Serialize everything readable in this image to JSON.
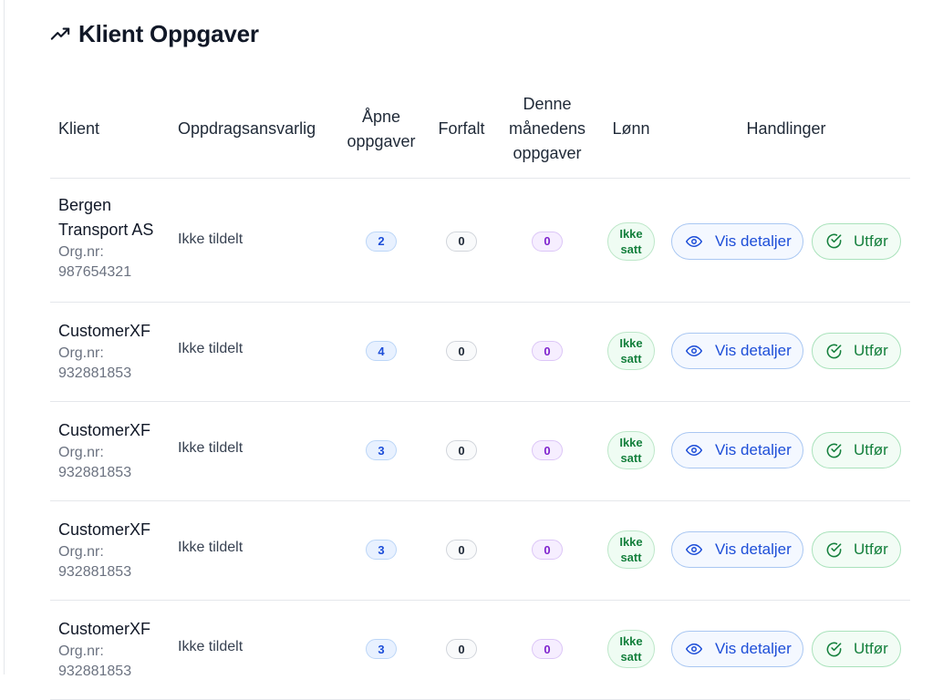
{
  "page": {
    "title": "Klient Oppgaver",
    "title_icon": "trending-up-icon"
  },
  "colors": {
    "blue": "#1d4ed8",
    "green": "#15803d",
    "purple": "#7e22ce",
    "gray": "#6b7280"
  },
  "table": {
    "headers": {
      "client": "Klient",
      "responsible": "Oppdragsansvarlig",
      "open_tasks": [
        "Åpne",
        "oppgaver"
      ],
      "overdue": "Forfalt",
      "month_tasks": [
        "Denne",
        "månedens",
        "oppgaver"
      ],
      "salary": "Lønn",
      "actions": "Handlinger"
    },
    "rows": [
      {
        "client": [
          "Bergen",
          "Transport AS"
        ],
        "org_label": "Org.nr:",
        "org": "987654321",
        "responsible": "Ikke tildelt",
        "open": "2",
        "overdue": "0",
        "month": "0",
        "salary": [
          "Ikke",
          "satt"
        ],
        "view_label": "Vis detaljer",
        "done_label": "Utfør"
      },
      {
        "client": [
          "CustomerXF"
        ],
        "org_label": "Org.nr:",
        "org": "932881853",
        "responsible": "Ikke tildelt",
        "open": "4",
        "overdue": "0",
        "month": "0",
        "salary": [
          "Ikke",
          "satt"
        ],
        "view_label": "Vis detaljer",
        "done_label": "Utfør"
      },
      {
        "client": [
          "CustomerXF"
        ],
        "org_label": "Org.nr:",
        "org": "932881853",
        "responsible": "Ikke tildelt",
        "open": "3",
        "overdue": "0",
        "month": "0",
        "salary": [
          "Ikke",
          "satt"
        ],
        "view_label": "Vis detaljer",
        "done_label": "Utfør"
      },
      {
        "client": [
          "CustomerXF"
        ],
        "org_label": "Org.nr:",
        "org": "932881853",
        "responsible": "Ikke tildelt",
        "open": "3",
        "overdue": "0",
        "month": "0",
        "salary": [
          "Ikke",
          "satt"
        ],
        "view_label": "Vis detaljer",
        "done_label": "Utfør"
      },
      {
        "client": [
          "CustomerXF"
        ],
        "org_label": "Org.nr:",
        "org": "932881853",
        "responsible": "Ikke tildelt",
        "open": "3",
        "overdue": "0",
        "month": "0",
        "salary": [
          "Ikke",
          "satt"
        ],
        "view_label": "Vis detaljer",
        "done_label": "Utfør"
      }
    ]
  }
}
